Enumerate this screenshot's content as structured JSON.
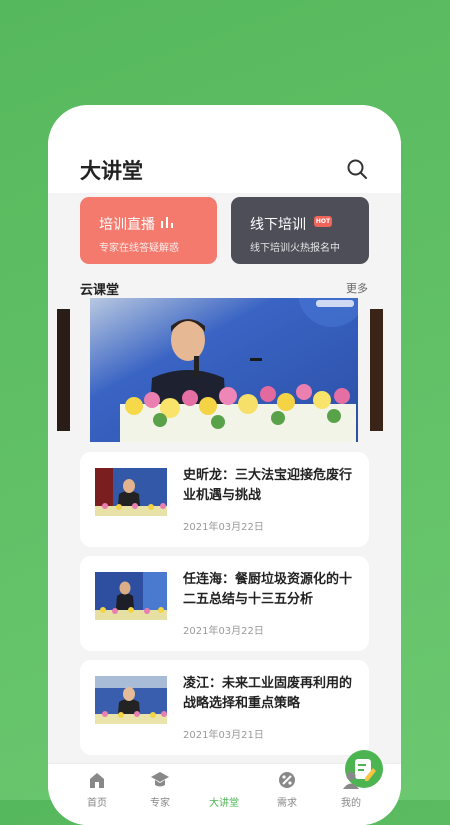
{
  "header": {
    "title": "大讲堂"
  },
  "promo": {
    "live": {
      "title": "培训直播",
      "subtitle": "专家在线答疑解惑"
    },
    "offline": {
      "title": "线下培训",
      "badge": "HOT",
      "subtitle": "线下培训火热报名中"
    }
  },
  "section": {
    "title": "云课堂",
    "more": "更多"
  },
  "courses": [
    {
      "title": "史昕龙：三大法宝迎接危废行业机遇与挑战",
      "date": "2021年03月22日"
    },
    {
      "title": "任连海：餐厨垃圾资源化的十二五总结与十三五分析",
      "date": "2021年03月22日"
    },
    {
      "title": "凌江：未来工业固废再利用的战略选择和重点策略",
      "date": "2021年03月21日"
    }
  ],
  "tabbar": {
    "tabs": [
      {
        "label": "首页",
        "icon": "home-icon"
      },
      {
        "label": "专家",
        "icon": "expert-icon"
      },
      {
        "label": "大讲堂",
        "icon": "edit-icon",
        "active": true
      },
      {
        "label": "需求",
        "icon": "demand-icon"
      },
      {
        "label": "我的",
        "icon": "user-icon"
      }
    ]
  },
  "colors": {
    "background": "#5cbc62",
    "accent": "#4cb552",
    "live_card": "#f47a6e",
    "offline_card": "#4e4e58",
    "hot_badge": "#f0645a"
  }
}
